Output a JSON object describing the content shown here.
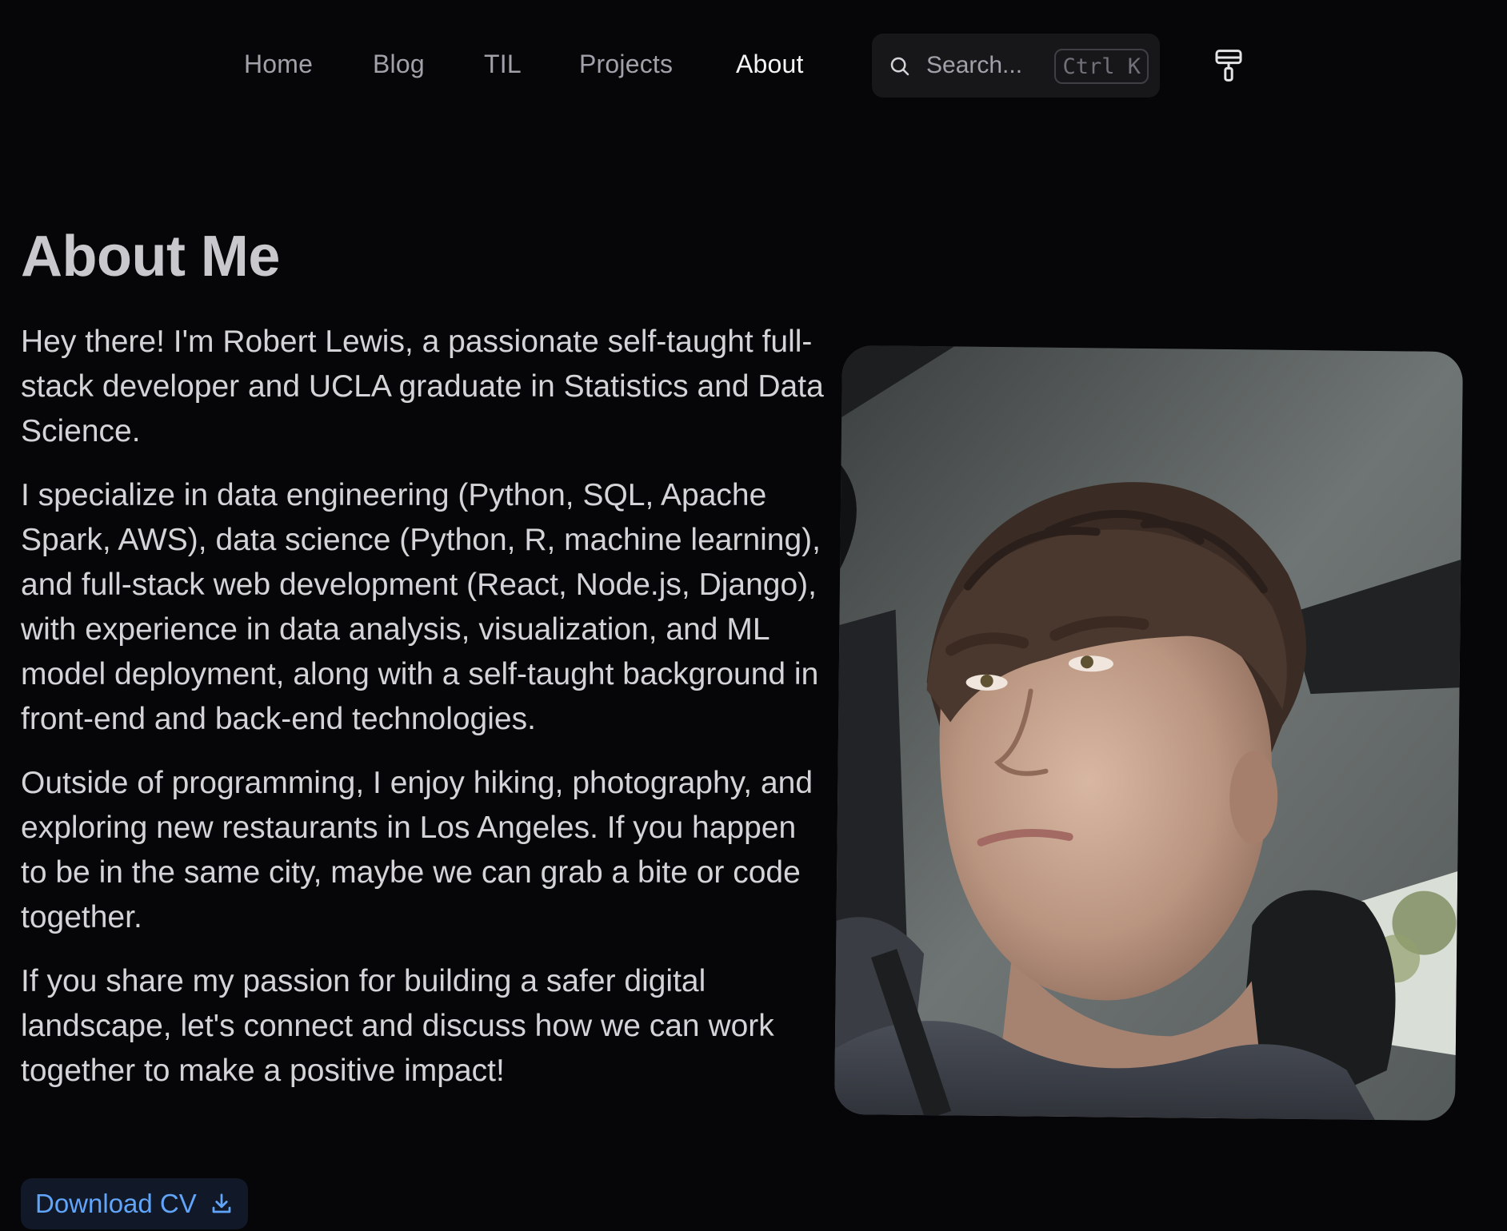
{
  "nav": {
    "items": [
      {
        "label": "Home",
        "active": false
      },
      {
        "label": "Blog",
        "active": false
      },
      {
        "label": "TIL",
        "active": false
      },
      {
        "label": "Projects",
        "active": false
      },
      {
        "label": "About",
        "active": true
      }
    ],
    "search": {
      "placeholder": "Search...",
      "shortcut": "Ctrl K",
      "icon": "search-icon"
    },
    "theme_icon": "paint-roller-icon"
  },
  "main": {
    "title": "About Me",
    "paragraphs": [
      "Hey there! I'm Robert Lewis, a passionate self-taught full-stack developer and UCLA graduate in Statistics and Data Science.",
      "I specialize in data engineering (Python, SQL, Apache Spark, AWS), data science (Python, R, machine learning), and full-stack web development (React, Node.js, Django), with experience in data analysis, visualization, and ML model deployment, along with a self-taught background in front-end and back-end technologies.",
      "Outside of programming, I enjoy hiking, photography, and exploring new restaurants in Los Angeles. If you happen to be in the same city, maybe we can grab a bite or code together.",
      "If you share my passion for building a safer digital landscape, let's connect and discuss how we can work together to make a positive impact!"
    ],
    "cv_button": {
      "label": "Download CV",
      "icon": "download-icon"
    }
  },
  "colors": {
    "background": "#060608",
    "text": "#d4d4d8",
    "nav_inactive": "#a1a1aa",
    "nav_active": "#f4f4f5",
    "link_accent": "#60a5fa"
  }
}
